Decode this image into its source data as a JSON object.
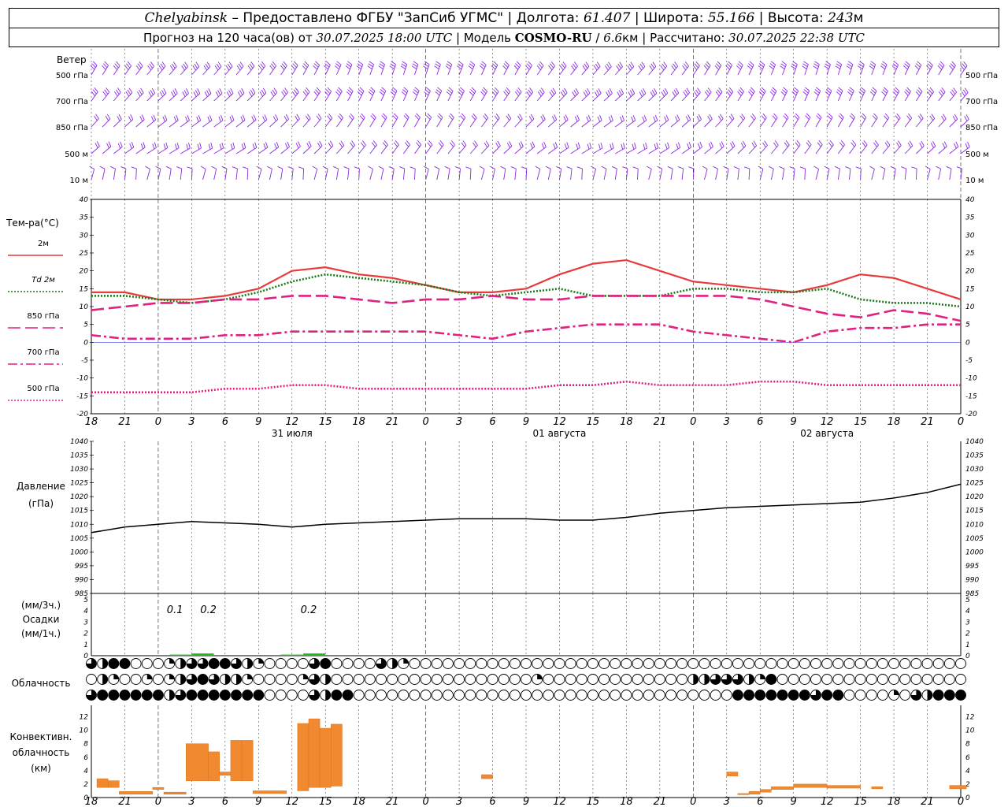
{
  "header": {
    "station": "Chelyabinsk",
    "dash": " – ",
    "provider": "Предоставлено ФГБУ \"ЗапСиб УГМС\"",
    "lon_label": "Долгота:",
    "lon_value": "61.407",
    "lat_label": "Широта:",
    "lat_value": "55.166",
    "alt_label": "Высота:",
    "alt_value": "243",
    "alt_unit": "м",
    "sep": " | ",
    "forecast_label": "Прогноз на 120 часа(ов)  от",
    "forecast_start": "30.07.2025 18:00 UTC",
    "model_label": "Модель",
    "model_name": "COSMO-RU",
    "model_res": "6.6",
    "model_res_unit": "км",
    "calc_label": "Рассчитано:",
    "calc_time": "30.07.2025 22:38 UTC"
  },
  "time_axis": {
    "hour_labels": [
      "18",
      "21",
      "0",
      "3",
      "6",
      "9",
      "12",
      "15",
      "18",
      "21",
      "0",
      "3",
      "6",
      "9",
      "12",
      "15",
      "18",
      "21",
      "0",
      "3",
      "6",
      "9",
      "12",
      "15",
      "18",
      "21",
      "0"
    ],
    "date_labels": [
      {
        "text": "31 июля",
        "hour": 18
      },
      {
        "text": "01 августа",
        "hour": 42
      },
      {
        "text": "02 августа",
        "hour": 66
      }
    ],
    "midnights": [
      6,
      30,
      54,
      78
    ]
  },
  "wind": {
    "title": "Ветер",
    "levels": [
      "500 гПа",
      "700 гПа",
      "850 гПа",
      "500 м",
      "10   м"
    ],
    "color": "#8a2be2"
  },
  "temperature": {
    "title": "Тем-ра(°C)",
    "ticks": [
      "40",
      "35",
      "30",
      "25",
      "20",
      "15",
      "10",
      "5",
      "0",
      "-5",
      "-10",
      "-15",
      "-20"
    ],
    "legend": [
      {
        "label": "2м",
        "color": "#e83a3a",
        "style": "solid"
      },
      {
        "label": "Td  2м",
        "color": "#1a7a1a",
        "style": "dotted"
      },
      {
        "label": "850 гПа",
        "color": "#e0217f",
        "style": "longdash"
      },
      {
        "label": "700 гПа",
        "color": "#e0217f",
        "style": "dashdot"
      },
      {
        "label": "500 гПа",
        "color": "#e0217f",
        "style": "dotted"
      }
    ]
  },
  "pressure": {
    "title1": "Давление",
    "title2": "(гПа)",
    "ticks": [
      "1040",
      "1035",
      "1030",
      "1025",
      "1020",
      "1015",
      "1010",
      "1005",
      "1000",
      "995",
      "990",
      "985"
    ]
  },
  "precip": {
    "unit1": "(мм/3ч.)",
    "title": "Осадки",
    "unit2": "(мм/1ч.)",
    "ticks": [
      "5",
      "4",
      "3",
      "2",
      "1",
      "0"
    ],
    "labels": [
      {
        "text": "0.1",
        "hour": 7.5
      },
      {
        "text": "0.2",
        "hour": 10.5
      },
      {
        "text": "0.2",
        "hour": 19.5
      }
    ]
  },
  "clouds": {
    "title": "Облачность"
  },
  "convective": {
    "title1": "Конвективн.",
    "title2": "облачность",
    "title3": "(км)",
    "ticks": [
      "12",
      "10",
      "8",
      "6",
      "4",
      "2",
      "0"
    ],
    "color": "#f0892f"
  },
  "chart_data": [
    {
      "type": "line",
      "title": "Тем-ра(°C)",
      "x_unit": "hours from 30.07.2025 18:00 UTC",
      "ylim": [
        -20,
        40
      ],
      "series": [
        {
          "name": "2м",
          "x": [
            0,
            3,
            6,
            9,
            12,
            15,
            18,
            21,
            24,
            27,
            30,
            33,
            36,
            39,
            42,
            45,
            48,
            51,
            54,
            57,
            60,
            63,
            66,
            69,
            72,
            75,
            78
          ],
          "values": [
            14,
            14,
            12,
            12,
            13,
            15,
            20,
            21,
            19,
            18,
            16,
            14,
            14,
            15,
            19,
            22,
            23,
            20,
            17,
            16,
            15,
            14,
            16,
            19,
            18,
            15,
            12
          ]
        },
        {
          "name": "Td  2м",
          "x": [
            0,
            3,
            6,
            9,
            12,
            15,
            18,
            21,
            24,
            27,
            30,
            33,
            36,
            39,
            42,
            45,
            48,
            51,
            54,
            57,
            60,
            63,
            66,
            69,
            72,
            75,
            78
          ],
          "values": [
            13,
            13,
            12,
            11,
            12,
            14,
            17,
            19,
            18,
            17,
            16,
            14,
            13,
            14,
            15,
            13,
            13,
            13,
            15,
            15,
            14,
            14,
            15,
            12,
            11,
            11,
            10
          ]
        },
        {
          "name": "850 гПа",
          "x": [
            0,
            3,
            6,
            9,
            12,
            15,
            18,
            21,
            24,
            27,
            30,
            33,
            36,
            39,
            42,
            45,
            48,
            51,
            54,
            57,
            60,
            63,
            66,
            69,
            72,
            75,
            78
          ],
          "values": [
            9,
            10,
            11,
            11,
            12,
            12,
            13,
            13,
            12,
            11,
            12,
            12,
            13,
            12,
            12,
            13,
            13,
            13,
            13,
            13,
            12,
            10,
            8,
            7,
            9,
            8,
            6
          ]
        },
        {
          "name": "700 гПа",
          "x": [
            0,
            3,
            6,
            9,
            12,
            15,
            18,
            21,
            24,
            27,
            30,
            33,
            36,
            39,
            42,
            45,
            48,
            51,
            54,
            57,
            60,
            63,
            66,
            69,
            72,
            75,
            78
          ],
          "values": [
            2,
            1,
            1,
            1,
            2,
            2,
            3,
            3,
            3,
            3,
            3,
            2,
            1,
            3,
            4,
            5,
            5,
            5,
            3,
            2,
            1,
            0,
            3,
            4,
            4,
            5,
            5
          ]
        },
        {
          "name": "500 гПа",
          "x": [
            0,
            3,
            6,
            9,
            12,
            15,
            18,
            21,
            24,
            27,
            30,
            33,
            36,
            39,
            42,
            45,
            48,
            51,
            54,
            57,
            60,
            63,
            66,
            69,
            72,
            75,
            78
          ],
          "values": [
            -14,
            -14,
            -14,
            -14,
            -13,
            -13,
            -12,
            -12,
            -13,
            -13,
            -13,
            -13,
            -13,
            -13,
            -12,
            -12,
            -11,
            -12,
            -12,
            -12,
            -11,
            -11,
            -12,
            -12,
            -12,
            -12,
            -12
          ]
        }
      ]
    },
    {
      "type": "line",
      "title": "Давление (гПа)",
      "x_unit": "hours from 30.07.2025 18:00 UTC",
      "ylim": [
        985,
        1040
      ],
      "series": [
        {
          "name": "",
          "x": [
            0,
            3,
            6,
            9,
            12,
            15,
            18,
            21,
            24,
            27,
            30,
            33,
            36,
            39,
            42,
            45,
            48,
            51,
            54,
            57,
            60,
            63,
            66,
            69,
            72,
            75,
            78
          ],
          "values": [
            1007,
            1009,
            1010,
            1011,
            1010.5,
            1010,
            1009,
            1010,
            1010.5,
            1011,
            1011.5,
            1012,
            1012,
            1012,
            1011.5,
            1011.5,
            1012.5,
            1014,
            1015,
            1016,
            1016.5,
            1017,
            1017.5,
            1018,
            1019.5,
            1021.5,
            1024.5
          ]
        }
      ]
    },
    {
      "type": "bar",
      "title": "Осадки",
      "x_unit": "hours from 30.07.2025 18:00 UTC",
      "ylim": [
        0,
        5
      ],
      "x": [
        8,
        10,
        18,
        20
      ],
      "values": [
        0.1,
        0.2,
        0.1,
        0.2
      ]
    },
    {
      "type": "bar",
      "title": "Конвективн. облачность (км)",
      "x_unit": "hours from 30.07.2025 18:00 UTC",
      "ylim": [
        0,
        13
      ],
      "bars": [
        {
          "x0": 0.5,
          "x1": 1.5,
          "bottom": 1.5,
          "top": 2.8
        },
        {
          "x0": 1.5,
          "x1": 2.5,
          "bottom": 1.5,
          "top": 2.5
        },
        {
          "x0": 2.5,
          "x1": 5.5,
          "bottom": 0.5,
          "top": 0.9
        },
        {
          "x0": 5.5,
          "x1": 6.5,
          "bottom": 1.2,
          "top": 1.5
        },
        {
          "x0": 6.5,
          "x1": 8.5,
          "bottom": 0.5,
          "top": 0.8
        },
        {
          "x0": 8.5,
          "x1": 10.5,
          "bottom": 2.5,
          "top": 8
        },
        {
          "x0": 10.5,
          "x1": 11.5,
          "bottom": 2.5,
          "top": 6.8
        },
        {
          "x0": 11.5,
          "x1": 12.5,
          "bottom": 3.3,
          "top": 3.8
        },
        {
          "x0": 12.5,
          "x1": 13.5,
          "bottom": 2.5,
          "top": 8.5
        },
        {
          "x0": 13.5,
          "x1": 14.5,
          "bottom": 2.5,
          "top": 8.5
        },
        {
          "x0": 14.5,
          "x1": 17.5,
          "bottom": 0.6,
          "top": 1.0
        },
        {
          "x0": 18.5,
          "x1": 19.5,
          "bottom": 1,
          "top": 11
        },
        {
          "x0": 19.5,
          "x1": 20.5,
          "bottom": 1.5,
          "top": 11.7
        },
        {
          "x0": 20.5,
          "x1": 21.5,
          "bottom": 1.5,
          "top": 10.3
        },
        {
          "x0": 21.5,
          "x1": 22.5,
          "bottom": 1.7,
          "top": 10.9
        },
        {
          "x0": 35,
          "x1": 36,
          "bottom": 2.8,
          "top": 3.4
        },
        {
          "x0": 57,
          "x1": 58,
          "bottom": 3.2,
          "top": 3.8
        },
        {
          "x0": 58,
          "x1": 59,
          "bottom": 0.5,
          "top": 0.6
        },
        {
          "x0": 59,
          "x1": 60,
          "bottom": 0.5,
          "top": 0.9
        },
        {
          "x0": 60,
          "x1": 61,
          "bottom": 0.8,
          "top": 1.2
        },
        {
          "x0": 61,
          "x1": 63,
          "bottom": 1.2,
          "top": 1.6
        },
        {
          "x0": 63,
          "x1": 66,
          "bottom": 1.5,
          "top": 2.0
        },
        {
          "x0": 66,
          "x1": 69,
          "bottom": 1.4,
          "top": 1.8
        },
        {
          "x0": 70,
          "x1": 71,
          "bottom": 1.3,
          "top": 1.6
        },
        {
          "x0": 77,
          "x1": 78.5,
          "bottom": 1.3,
          "top": 1.8
        }
      ]
    }
  ]
}
